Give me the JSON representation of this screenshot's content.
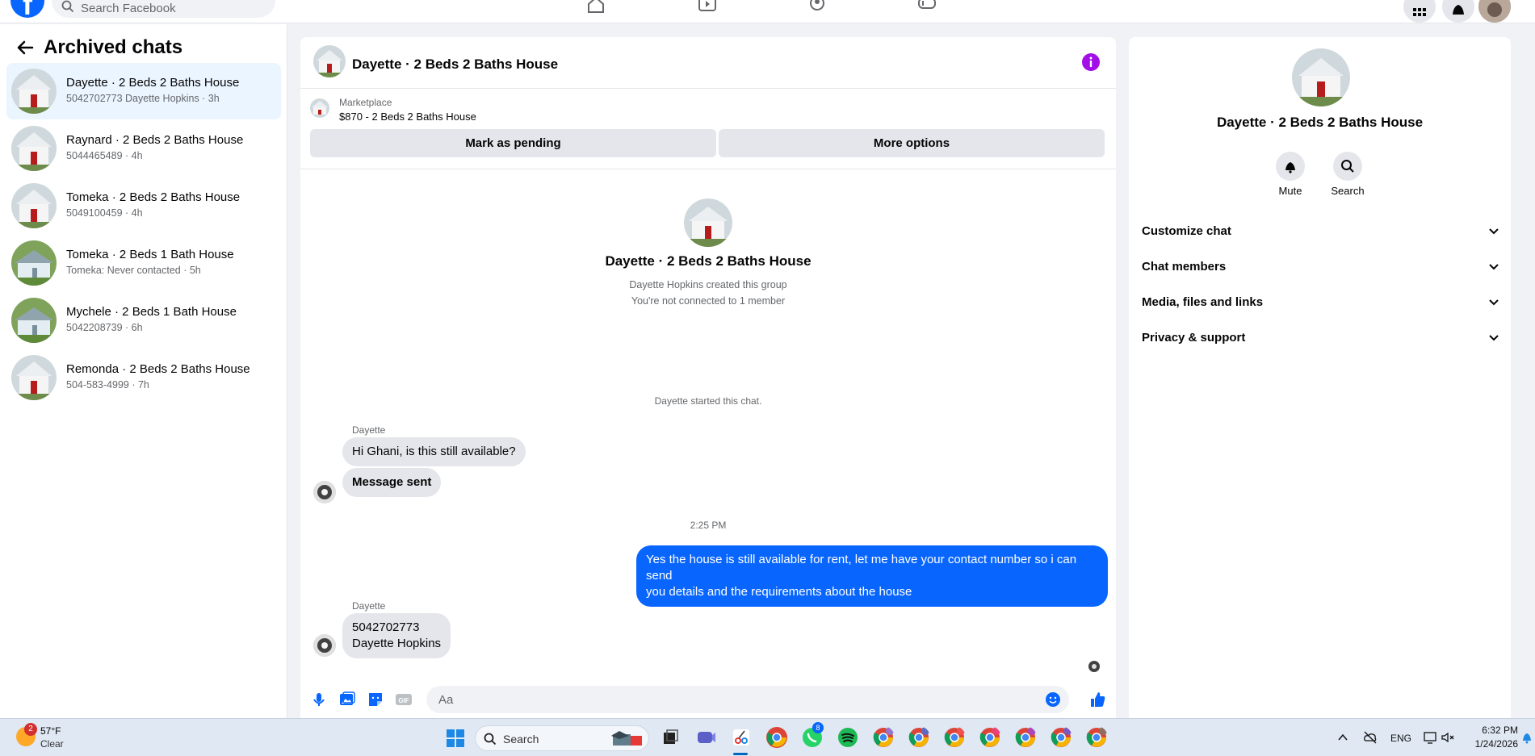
{
  "topbar": {
    "search_placeholder": "Search Facebook"
  },
  "sidebar": {
    "title": "Archived chats",
    "chats": [
      {
        "title": "Dayette · 2 Beds 2 Baths House",
        "subtitle": "5042702773 Dayette Hopkins · 3h",
        "active": true
      },
      {
        "title": "Raynard · 2 Beds 2 Baths House",
        "subtitle": "5044465489 · 4h"
      },
      {
        "title": "Tomeka · 2 Beds 2 Baths House",
        "subtitle": "5049100459 · 4h"
      },
      {
        "title": "Tomeka · 2 Beds 1 Bath House",
        "subtitle": "Tomeka: Never contacted · 5h"
      },
      {
        "title": "Mychele · 2 Beds 1 Bath House",
        "subtitle": "5042208739 · 6h"
      },
      {
        "title": "Remonda · 2 Beds 2 Baths House",
        "subtitle": "504-583-4999 · 7h"
      }
    ]
  },
  "chat": {
    "title": "Dayette · 2 Beds 2 Baths House",
    "marketplace_label": "Marketplace",
    "listing": "$870 - 2 Beds 2 Baths House",
    "pending_button": "Mark as pending",
    "more_button": "More options",
    "intro_title": "Dayette · 2 Beds 2 Baths House",
    "intro_line1": "Dayette Hopkins created this group",
    "intro_line2": "You're not connected to 1 member",
    "started": "Dayette started this chat.",
    "sender_name": "Dayette",
    "msg1": "Hi Ghani, is this still available?",
    "msg2": "Message sent",
    "time1": "2:25 PM",
    "msg_out_line1": "Yes the house is still available for rent, let me have your contact number so i can send",
    "msg_out_line2": "you details and the requirements about the house",
    "sender_name2": "Dayette",
    "msg3_line1": "5042702773",
    "msg3_line2": "Dayette Hopkins",
    "composer_placeholder": "Aa"
  },
  "details": {
    "title": "Dayette · 2 Beds 2 Baths House",
    "mute_label": "Mute",
    "search_label": "Search",
    "sections": [
      "Customize chat",
      "Chat members",
      "Media, files and links",
      "Privacy & support"
    ]
  },
  "taskbar": {
    "weather_badge": "2",
    "temp": "57°F",
    "condition": "Clear",
    "search": "Search",
    "whatsapp_badge": "8",
    "lang": "ENG",
    "time": "6:32 PM",
    "date": "1/24/2026"
  },
  "colors": {
    "accent": "#0866ff",
    "info": "#a30fe8",
    "active_row": "#ebf5ff"
  }
}
